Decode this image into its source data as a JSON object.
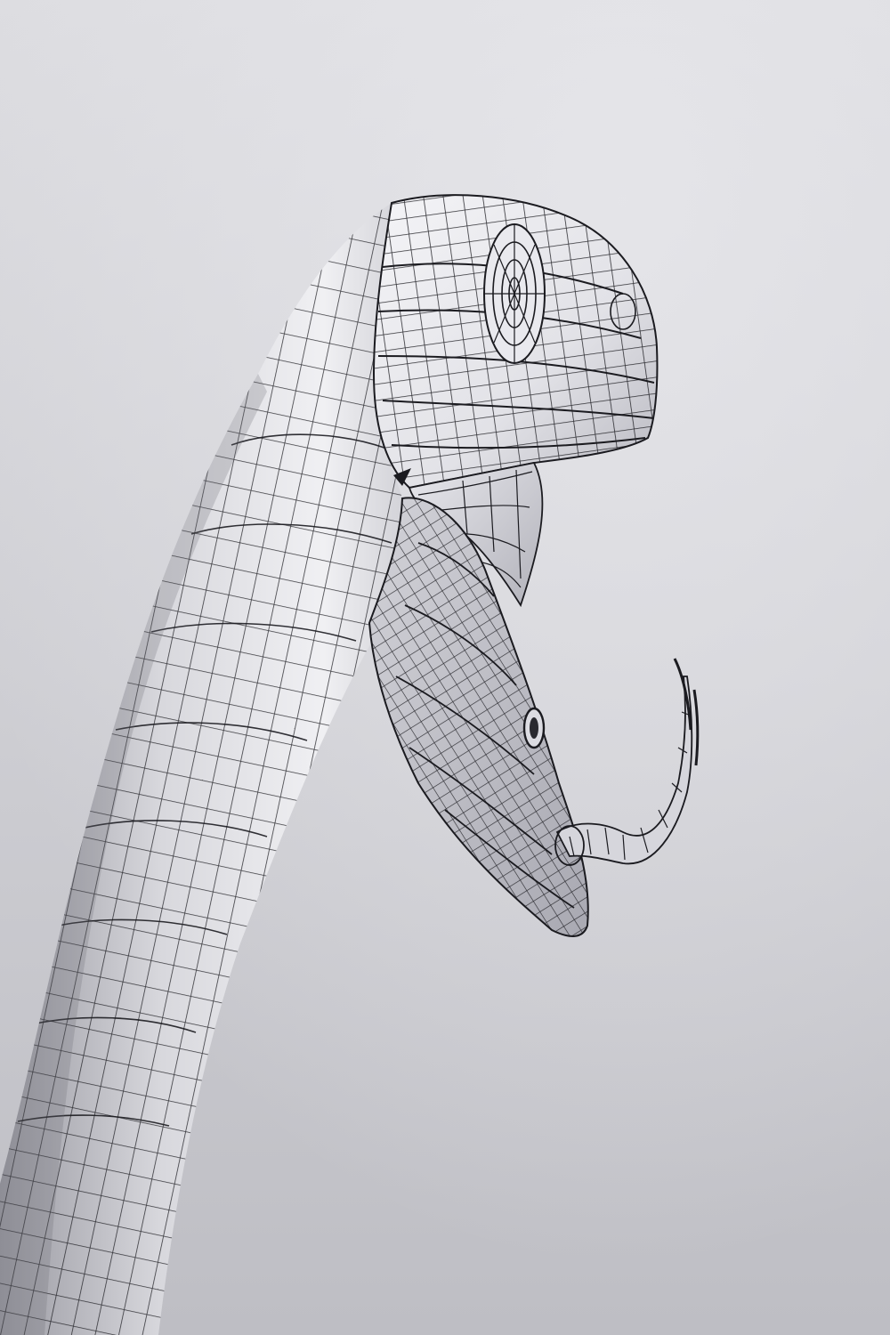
{
  "scene": {
    "subject": "snake-head-wireframe",
    "render_style": "clay-render-with-quad-wireframe",
    "mouth_state": "open",
    "tongue": "forked",
    "colors": {
      "background_light": "#dedee2",
      "background_dark": "#b9b9bf",
      "surface_light": "#f3f3f6",
      "surface_mid": "#c9c9cf",
      "surface_dark": "#8e8e96",
      "mouth_interior": "#b5b5bd",
      "wire": "#1b1b20"
    }
  }
}
